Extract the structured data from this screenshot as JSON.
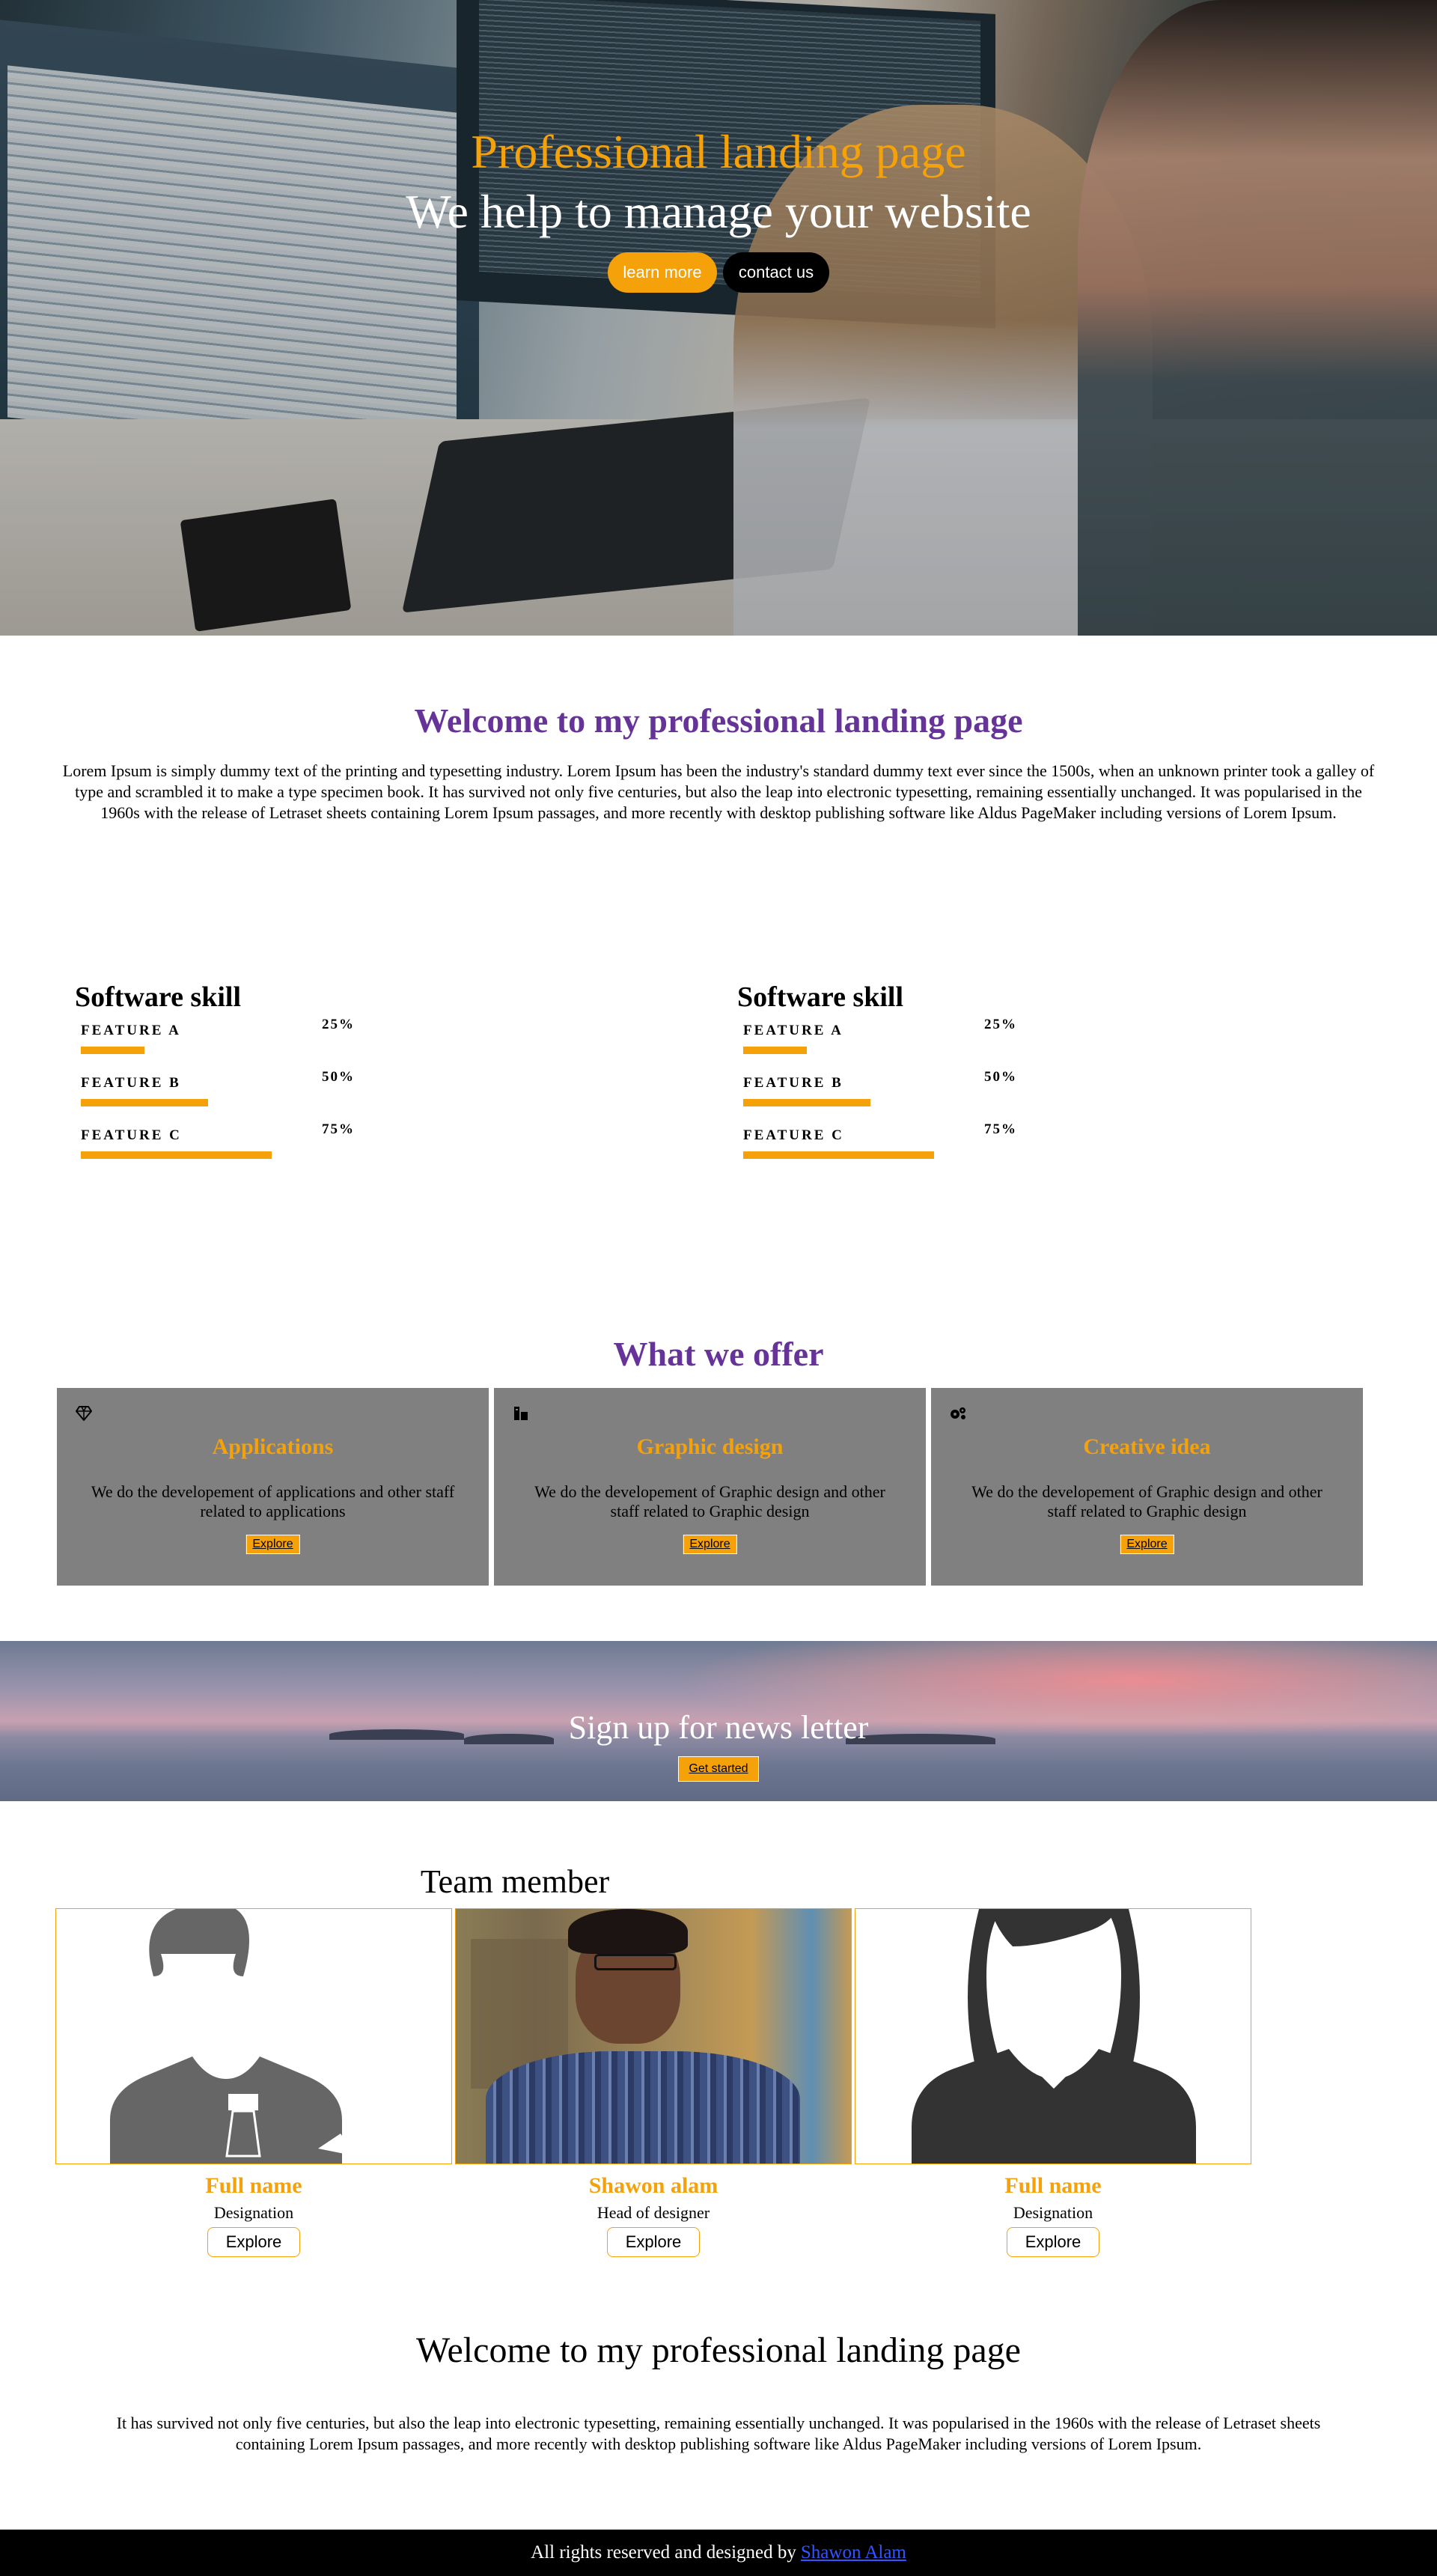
{
  "hero": {
    "title": "Professional landing page",
    "subtitle": "We help to manage your website",
    "learn_label": "learn more",
    "contact_label": "contact us"
  },
  "welcome": {
    "title": "Welcome to my professional landing page",
    "text": "Lorem Ipsum is simply dummy text of the printing and typesetting industry. Lorem Ipsum has been the industry's standard dummy text ever since the 1500s, when an unknown printer took a galley of type and scrambled it to make a type specimen book. It has survived not only five centuries, but also the leap into electronic typesetting, remaining essentially unchanged. It was popularised in the 1960s with the release of Letraset sheets containing Lorem Ipsum passages, and more recently with desktop publishing software like Aldus PageMaker including versions of Lorem Ipsum."
  },
  "skills": [
    {
      "title": "Software skill",
      "items": [
        {
          "label": "FEATURE A",
          "percent_text": "25%",
          "level": 0.25
        },
        {
          "label": "FEATURE B",
          "percent_text": "50%",
          "level": 0.5
        },
        {
          "label": "FEATURE C",
          "percent_text": "75%",
          "level": 0.75
        }
      ]
    },
    {
      "title": "Software skill",
      "items": [
        {
          "label": "FEATURE A",
          "percent_text": "25%",
          "level": 0.25
        },
        {
          "label": "FEATURE B",
          "percent_text": "50%",
          "level": 0.5
        },
        {
          "label": "FEATURE C",
          "percent_text": "75%",
          "level": 0.75
        }
      ]
    }
  ],
  "offer": {
    "title": "What we offer",
    "cards": [
      {
        "icon": "diamond-icon",
        "title": "Applications",
        "text": "We do the developement of applications and other staff related to applications",
        "button": "Explore"
      },
      {
        "icon": "design-tools-icon",
        "title": "Graphic design",
        "text": "We do the developement of Graphic design and other staff related to Graphic design",
        "button": "Explore"
      },
      {
        "icon": "gears-icon",
        "title": "Creative idea",
        "text": "We do the developement of Graphic design and other staff related to Graphic design",
        "button": "Explore"
      }
    ]
  },
  "newsletter": {
    "title": "Sign up for news letter",
    "button": "Get started"
  },
  "team": {
    "title": "Team member",
    "members": [
      {
        "name": "Full name",
        "role": "Designation",
        "button": "Explore"
      },
      {
        "name": "Shawon alam",
        "role": "Head of designer",
        "button": "Explore"
      },
      {
        "name": "Full name",
        "role": "Designation",
        "button": "Explore"
      }
    ]
  },
  "closing": {
    "title": "Welcome to my professional landing page",
    "text": "It has survived not only five centuries, but also the leap into electronic typesetting, remaining essentially unchanged. It was popularised in the 1960s with the release of Letraset sheets containing Lorem Ipsum passages, and more recently with desktop publishing software like Aldus PageMaker including versions of Lorem Ipsum."
  },
  "footer": {
    "text": "All rights reserved and designed by",
    "link": "Shawon Alam"
  },
  "colors": {
    "accent": "#f5a10a",
    "heading_purple": "#663399",
    "card_gray": "#808080",
    "footer_bg": "#000000"
  }
}
